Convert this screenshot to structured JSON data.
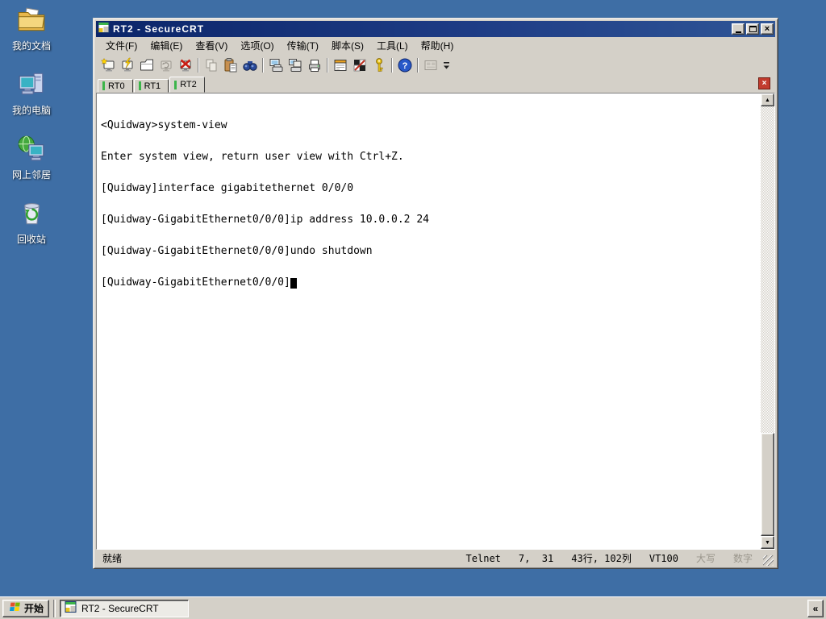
{
  "app": {
    "name": "SecureCRT"
  },
  "colors": {
    "desktop_background": "#3E6EA5",
    "titlebar_gradient_start": "#0B2569",
    "titlebar_gradient_end": "#2F5596",
    "window_chrome": "#D4D0C8",
    "tab_indicator_green": "#3CB54A",
    "tab_close_red": "#C23B2E",
    "terminal_background": "#FFFFFF",
    "terminal_text": "#000000"
  },
  "desktop": {
    "icons": [
      {
        "label": "我的文档",
        "icon": "my-documents-icon"
      },
      {
        "label": "我的电脑",
        "icon": "my-computer-icon"
      },
      {
        "label": "网上邻居",
        "icon": "network-places-icon"
      },
      {
        "label": "回收站",
        "icon": "recycle-bin-icon"
      }
    ]
  },
  "window": {
    "title": "RT2 - SecureCRT",
    "menu": [
      "文件(F)",
      "编辑(E)",
      "查看(V)",
      "选项(O)",
      "传输(T)",
      "脚本(S)",
      "工具(L)",
      "帮助(H)"
    ],
    "toolbar_buttons": [
      "quick-connect",
      "connect",
      "new-tab",
      "reconnect",
      "disconnect",
      "copy",
      "paste",
      "find",
      "print-preview",
      "print-setup",
      "print",
      "session-options",
      "global-options",
      "keymap",
      "help",
      "misc",
      "toolbar-overflow"
    ],
    "tabs": [
      {
        "label": "RT0"
      },
      {
        "label": "RT1"
      },
      {
        "label": "RT2"
      }
    ],
    "active_tab": "RT2",
    "terminal": {
      "lines": [
        "<Quidway>system-view",
        "Enter system view, return user view with Ctrl+Z.",
        "[Quidway]interface gigabitethernet 0/0/0",
        "[Quidway-GigabitEthernet0/0/0]ip address 10.0.0.2 24",
        "[Quidway-GigabitEthernet0/0/0]undo shutdown",
        "[Quidway-GigabitEthernet0/0/0]"
      ]
    },
    "status": {
      "ready": "就绪",
      "protocol": "Telnet",
      "cursor_position": "7,  31",
      "terminal_size": "43行, 102列",
      "emulation": "VT100",
      "caps": "大写",
      "num": "数字"
    }
  },
  "taskbar": {
    "start": "开始",
    "tasks": [
      {
        "label": "RT2 - SecureCRT",
        "active": true
      }
    ]
  },
  "icons": {
    "close_glyph": "×",
    "collapse_glyph": "«",
    "scroll_up_glyph": "▲",
    "scroll_down_glyph": "▼"
  }
}
